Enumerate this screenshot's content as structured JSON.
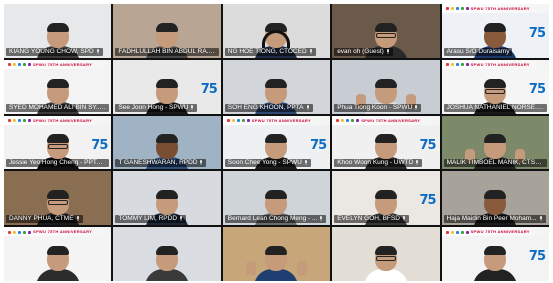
{
  "meeting": {
    "banner_text": "SPWU 75TH ANNIVERSARY",
    "logo_text": "75",
    "accent_colors": {
      "logo_blue": "#0d6cc4",
      "banner_red": "#cc0033",
      "speaker_green": "#7ac143"
    },
    "participants": [
      {
        "name": "KIANG YOUNG CHOW, SPD",
        "banner": false,
        "logo": false,
        "bg": "#e6e8ea",
        "shirt": "#3b3b3b",
        "mic": true
      },
      {
        "name": "FADHLULLAH BIN ABDUL RA...",
        "banner": false,
        "logo": false,
        "bg": "#b9a593",
        "shirt": "#4a4a4a",
        "mic": true
      },
      {
        "name": "NG HOE TIONG, CTOCED",
        "banner": false,
        "logo": false,
        "bg": "#dcdcdc",
        "shirt": "#1f2d48",
        "mic": true,
        "headphones": true
      },
      {
        "name": "evan oh (Guest)",
        "banner": false,
        "logo": false,
        "bg": "#6b5a49",
        "shirt": "#2a2a2a",
        "mic": true,
        "glasses": true
      },
      {
        "name": "Arasu S/O Duraisamy",
        "banner": true,
        "logo": true,
        "bg": "#eef2f6",
        "shirt": "#1d3b6a",
        "mic": false,
        "skin": "#8a5a3c"
      },
      {
        "name": "SYED MOHAMED ALI BIN SY...",
        "banner": true,
        "logo": false,
        "bg": "#f3f3f3",
        "shirt": "#3c3c3c",
        "mic": true
      },
      {
        "name": "See Joon Hong - SPWU",
        "banner": false,
        "logo": true,
        "bg": "#e9e9e9",
        "shirt": "#1a1a1a",
        "mic": true
      },
      {
        "name": "SOH ENG KHOON, PPTA",
        "banner": false,
        "logo": false,
        "bg": "#d2d6da",
        "shirt": "#2e4a73",
        "mic": true
      },
      {
        "name": "Phua Tiong Koon - SPWU",
        "banner": false,
        "logo": false,
        "bg": "#c7cdd3",
        "shirt": "#e0e0e0",
        "mic": true,
        "thumbs": true
      },
      {
        "name": "JOSHUA NATHANIEL NORSE...",
        "banner": true,
        "logo": true,
        "bg": "#f5f5f5",
        "shirt": "#1b1b1b",
        "mic": true,
        "glasses": true
      },
      {
        "name": "Jessie Yeo Hong Cheng - PPTA",
        "banner": true,
        "logo": true,
        "bg": "#f2f2f2",
        "shirt": "#111111",
        "mic": true,
        "glasses": true
      },
      {
        "name": "T GANESHWARAN, RPDD",
        "banner": false,
        "logo": false,
        "bg": "#9fb3c4",
        "shirt": "#2b4e7a",
        "mic": true,
        "skin": "#7a4e33"
      },
      {
        "name": "Soon Chee Yong - SPWU",
        "banner": true,
        "logo": true,
        "bg": "#eef0f2",
        "shirt": "#1f1f1f",
        "mic": true
      },
      {
        "name": "Khoo Woon Kung - UWTD",
        "banner": true,
        "logo": true,
        "bg": "#f0f0f0",
        "shirt": "#2a2a2a",
        "mic": true
      },
      {
        "name": "MALIK TIMBOEL MANIK, CTSR",
        "banner": false,
        "logo": false,
        "bg": "#7d8a6a",
        "shirt": "#222222",
        "mic": true,
        "thumbs": true
      },
      {
        "name": "DANNY PHUA, CTME",
        "banner": false,
        "logo": false,
        "bg": "#8a6e52",
        "shirt": "#1c1c1c",
        "mic": true,
        "glasses": true
      },
      {
        "name": "TOMMY LIM, RPDD",
        "banner": false,
        "logo": false,
        "bg": "#d7dbe0",
        "shirt": "#1d2a3c",
        "mic": true
      },
      {
        "name": "Bernard Lean Chong Meng - ...",
        "banner": false,
        "logo": false,
        "bg": "#cfd4d8",
        "shirt": "#6d6d6d",
        "mic": true
      },
      {
        "name": "EVELYN GOH, BFSD",
        "banner": false,
        "logo": true,
        "bg": "#ebe7e2",
        "shirt": "#3a3a3a",
        "mic": true
      },
      {
        "name": "Haja Maidin Bin Peer Moham...",
        "banner": false,
        "logo": false,
        "bg": "#a8a39a",
        "shirt": "#1c1c1c",
        "mic": true,
        "skin": "#8a5a3c"
      },
      {
        "name": "",
        "banner": true,
        "logo": false,
        "bg": "#f4f4f4",
        "shirt": "#2c2c2c",
        "mic": false
      },
      {
        "name": "",
        "banner": false,
        "logo": false,
        "bg": "#d9dde1",
        "shirt": "#3a3a3a",
        "mic": false
      },
      {
        "name": "",
        "banner": false,
        "logo": false,
        "bg": "#c7a77a",
        "shirt": "#1f3f73",
        "mic": false,
        "thumbs": true
      },
      {
        "name": "",
        "banner": false,
        "logo": false,
        "bg": "#e2ded6",
        "shirt": "#ffffff",
        "mic": false,
        "glasses": true
      },
      {
        "name": "",
        "banner": true,
        "logo": true,
        "bg": "#f3f3f3",
        "shirt": "#222222",
        "mic": false
      }
    ]
  }
}
